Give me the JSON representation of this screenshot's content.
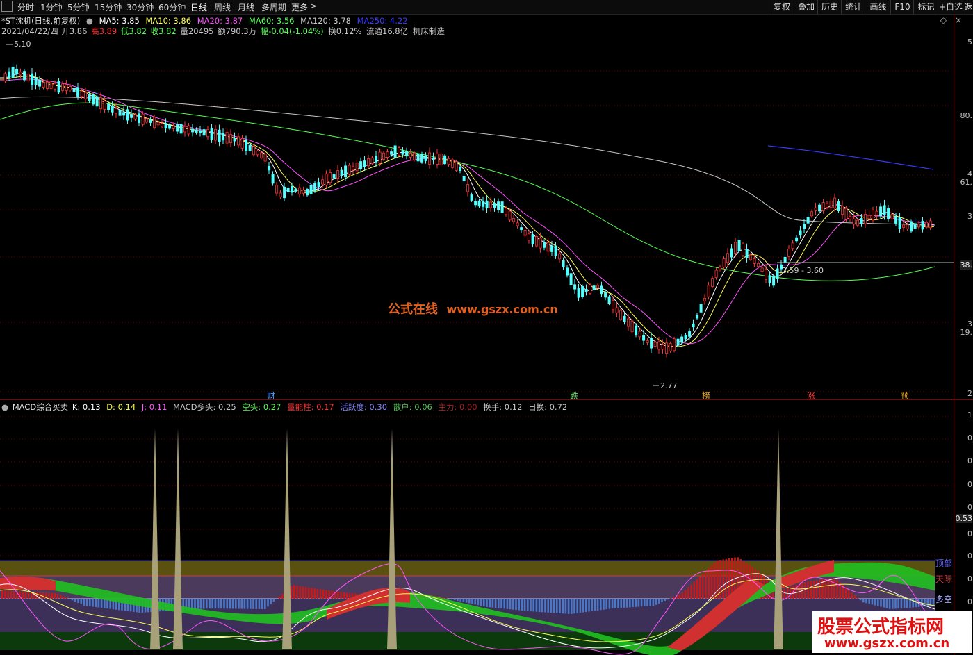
{
  "toolbar": {
    "left_items": [
      "分时",
      "1分钟",
      "5分钟",
      "15分钟",
      "30分钟",
      "60分钟",
      "日线",
      "周线",
      "月线",
      "多周期",
      "更多"
    ],
    "active": "日线",
    "right_items": [
      "复权",
      "叠加",
      "历史",
      "统计",
      "画线",
      "F10",
      "标记",
      "+自选",
      "返"
    ]
  },
  "ma_line": {
    "title": "*ST沈机(日线,前复权)",
    "ma5": "MA5: 3.85",
    "ma10": "MA10: 3.86",
    "ma20": "MA20: 3.87",
    "ma60": "MA60: 3.56",
    "ma120": "MA120: 3.78",
    "ma250": "MA250: 4.22"
  },
  "quote_line": {
    "date": "2021/04/22/四",
    "open": "开3.86",
    "high": "高3.89",
    "low": "低3.82",
    "close": "收3.82",
    "volume": "量20495",
    "amount": "额790.3万",
    "change": "幅-0.04(-1.04%)",
    "turnover": "换0.12%",
    "float": "流通16.8亿",
    "industry": "机床制造"
  },
  "price_labels": {
    "high": "5.10",
    "low": "2.77",
    "zone": "3.59 - 3.60",
    "current_axis": "38."
  },
  "price_axis": [
    "5",
    "80.",
    "4",
    "61.",
    "3",
    "3",
    "19.",
    "2"
  ],
  "events": [
    {
      "label": "财",
      "color": "#4a9cff"
    },
    {
      "label": "跌",
      "color": "#6cdc6c"
    },
    {
      "label": "榜",
      "color": "#e0a020"
    },
    {
      "label": "涨",
      "color": "#ff4040"
    },
    {
      "label": "预",
      "color": "#e0a020"
    }
  ],
  "watermark": {
    "cn": "公式在线",
    "url": "www.gszx.com.cn"
  },
  "indicator_line": {
    "name": "MACD综合买卖",
    "k": "K: 0.13",
    "d": "D: 0.14",
    "j": "J: 0.11",
    "macd_bull": "MACD多头: 0.25",
    "kong": "空头: 0.27",
    "power": "量能柱: 0.17",
    "active": "活跃度: 0.30",
    "retail": "散户: 0.06",
    "main": "主力: 0.00",
    "hand": "换手: 0.12",
    "day": "日换: 0.72"
  },
  "indicator_axis": [
    "1",
    "0",
    "0",
    "0",
    "0",
    "0.53",
    "0",
    "0",
    "0",
    "0",
    "0"
  ],
  "indicator_labels": {
    "top": "顶部",
    "sky": "天际",
    "bull_bear": "多空"
  },
  "logo": {
    "title": "股票公式指标网",
    "url": "www.gszx.com.cn"
  },
  "colors": {
    "up": "#ff3232",
    "down": "#54ffff",
    "ma5": "#ffffff",
    "ma10": "#ffff54",
    "ma20": "#ff54ff",
    "ma60": "#54ff54",
    "ma120": "#c8c8c8",
    "ma250": "#3a3aff",
    "grid": "#7a0000"
  },
  "chart_data": {
    "type": "candlestick",
    "high": 5.1,
    "low": 2.77,
    "last": {
      "open": 3.86,
      "high": 3.89,
      "low": 3.82,
      "close": 3.82
    },
    "ma": {
      "MA5": 3.85,
      "MA10": 3.86,
      "MA20": 3.87,
      "MA60": 3.56,
      "MA120": 3.78,
      "MA250": 4.22
    }
  }
}
